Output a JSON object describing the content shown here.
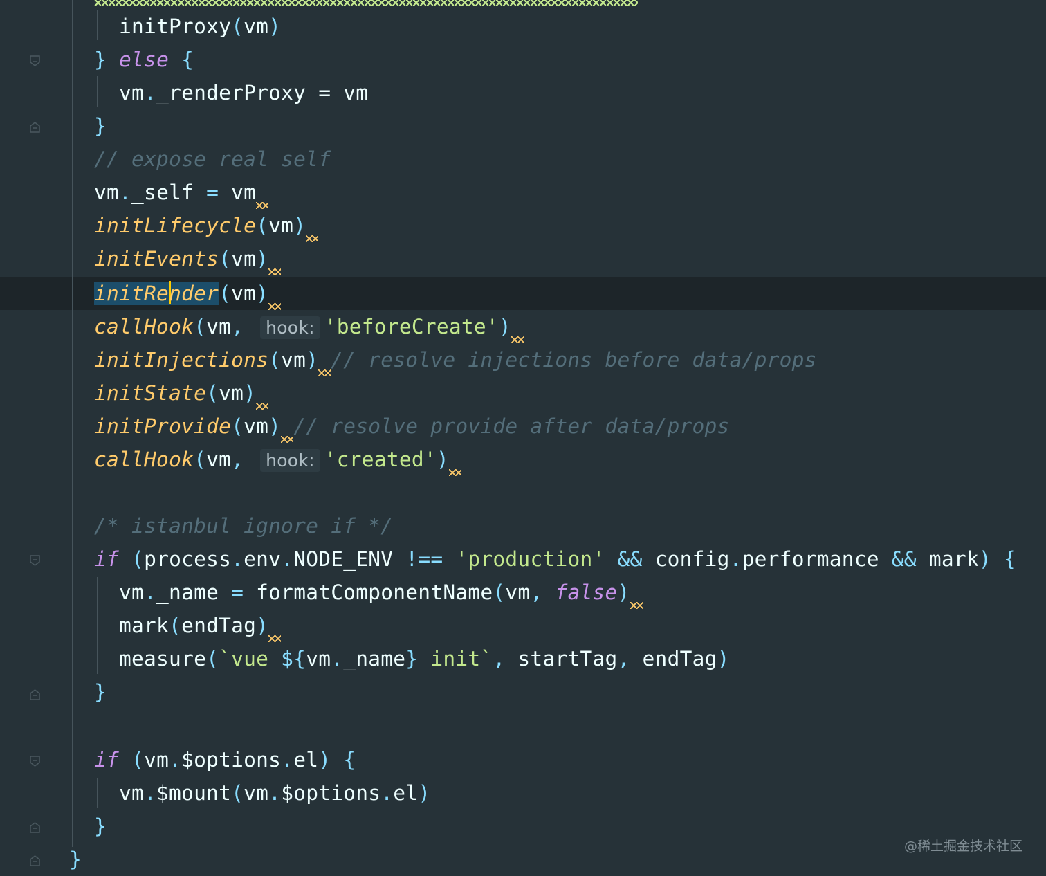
{
  "editor": {
    "lines": [
      {
        "id": 0,
        "text": "initProxy(vm)"
      },
      {
        "id": 1,
        "text": "} else {"
      },
      {
        "id": 2,
        "text": "vm._renderProxy = vm"
      },
      {
        "id": 3,
        "text": "}"
      },
      {
        "id": 4,
        "text": "// expose real self"
      },
      {
        "id": 5,
        "text": "vm._self = vm"
      },
      {
        "id": 6,
        "text": "initLifecycle(vm)"
      },
      {
        "id": 7,
        "text": "initEvents(vm)"
      },
      {
        "id": 8,
        "text": "initRender(vm)"
      },
      {
        "id": 9,
        "text": "callHook(vm, 'beforeCreate')"
      },
      {
        "id": 10,
        "text": "initInjections(vm) // resolve injections before data/props"
      },
      {
        "id": 11,
        "text": "initState(vm)"
      },
      {
        "id": 12,
        "text": "initProvide(vm) // resolve provide after data/props"
      },
      {
        "id": 13,
        "text": "callHook(vm, 'created')"
      },
      {
        "id": 14,
        "text": ""
      },
      {
        "id": 15,
        "text": "/* istanbul ignore if */"
      },
      {
        "id": 16,
        "text": "if (process.env.NODE_ENV !== 'production' && config.performance && mark) {"
      },
      {
        "id": 17,
        "text": "vm._name = formatComponentName(vm, false)"
      },
      {
        "id": 18,
        "text": "mark(endTag)"
      },
      {
        "id": 19,
        "text": "measure(`vue ${vm._name} init`, startTag, endTag)"
      },
      {
        "id": 20,
        "text": "}"
      },
      {
        "id": 21,
        "text": ""
      },
      {
        "id": 22,
        "text": "if (vm.$options.el) {"
      },
      {
        "id": 23,
        "text": "vm.$mount(vm.$options.el)"
      },
      {
        "id": 24,
        "text": "}"
      },
      {
        "id": 25,
        "text": "}"
      }
    ],
    "inlay_hint_label": "hook:",
    "current_line_index": 8
  },
  "watermark": "@稀土掘金技术社区",
  "colors": {
    "background": "#263238",
    "current_line": "#1d2529",
    "function": "#ffcb6b",
    "keyword": "#c792ea",
    "string": "#c3e88d",
    "punctuation": "#89ddff",
    "comment": "#546e7a",
    "identifier": "#eeffff"
  },
  "icons": {
    "fold_markers": [
      "fold-close-icon"
    ]
  }
}
